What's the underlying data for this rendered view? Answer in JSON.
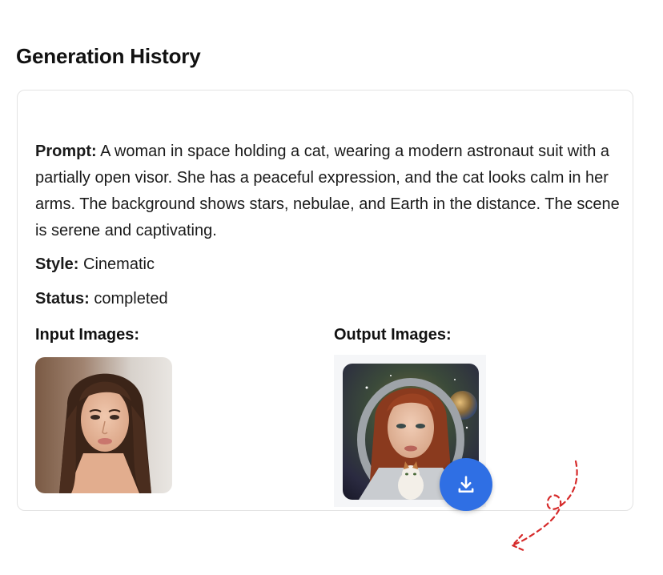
{
  "page": {
    "title": "Generation History"
  },
  "history_item": {
    "prompt_label": "Prompt:",
    "prompt_text": "A woman in space holding a cat, wearing a modern astronaut suit with a partially open visor. She has a peaceful expression, and the cat looks calm in her arms. The background shows stars, nebulae, and Earth in the distance. The scene is serene and captivating.",
    "style_label": "Style:",
    "style_value": "Cinematic",
    "status_label": "Status:",
    "status_value": "completed",
    "input_images_label": "Input Images:",
    "output_images_label": "Output Images:"
  },
  "icons": {
    "download": "download-icon",
    "annotation": "dashed-arrow-annotation"
  },
  "colors": {
    "accent": "#2f6fe4",
    "annotation": "#d62b2b",
    "border": "#e3e3e3"
  }
}
